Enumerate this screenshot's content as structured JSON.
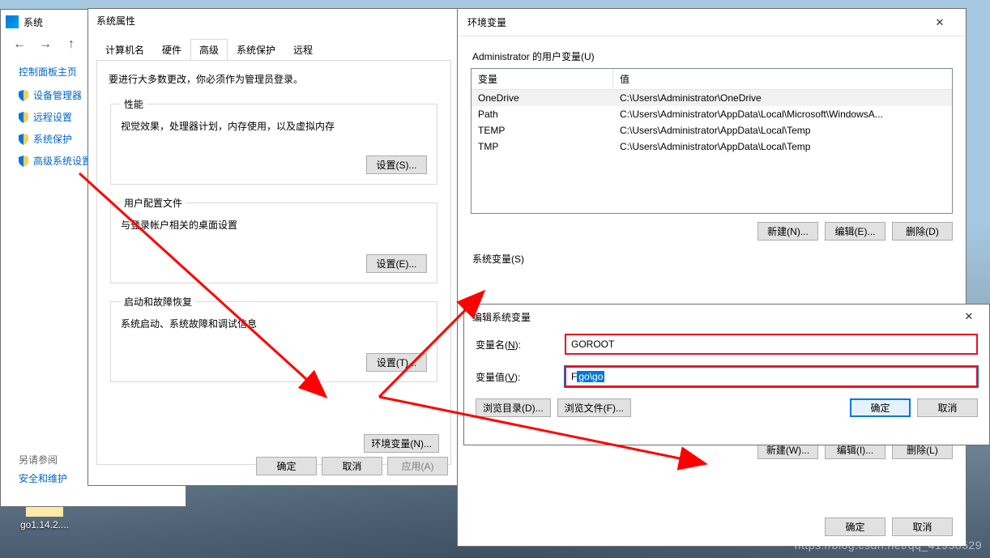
{
  "desktop": {
    "icon_label": "go1.14.2...."
  },
  "system_window": {
    "title": "系统",
    "home": "控制面板主页",
    "links": [
      "设备管理器",
      "远程设置",
      "系统保护",
      "高级系统设置"
    ],
    "see_also": "另请参阅",
    "security": "安全和维护"
  },
  "props": {
    "title": "系统属性",
    "tabs": [
      "计算机名",
      "硬件",
      "高级",
      "系统保护",
      "远程"
    ],
    "active_tab_index": 2,
    "note": "要进行大多数更改，你必须作为管理员登录。",
    "perf_legend": "性能",
    "perf_desc": "视觉效果，处理器计划，内存使用，以及虚拟内存",
    "perf_btn": "设置(S)...",
    "profile_legend": "用户配置文件",
    "profile_desc": "与登录帐户相关的桌面设置",
    "profile_btn": "设置(E)...",
    "startup_legend": "启动和故障恢复",
    "startup_desc": "系统启动、系统故障和调试信息",
    "startup_btn": "设置(T)...",
    "env_btn": "环境变量(N)...",
    "ok": "确定",
    "cancel": "取消",
    "apply": "应用(A)"
  },
  "env": {
    "title": "环境变量",
    "user_label": "Administrator 的用户变量(U)",
    "col_var": "变量",
    "col_val": "值",
    "user_vars": [
      {
        "name": "OneDrive",
        "value": "C:\\Users\\Administrator\\OneDrive"
      },
      {
        "name": "Path",
        "value": "C:\\Users\\Administrator\\AppData\\Local\\Microsoft\\WindowsA..."
      },
      {
        "name": "TEMP",
        "value": "C:\\Users\\Administrator\\AppData\\Local\\Temp"
      },
      {
        "name": "TMP",
        "value": "C:\\Users\\Administrator\\AppData\\Local\\Temp"
      }
    ],
    "new_btn": "新建(N)...",
    "edit_btn": "编辑(E)...",
    "del_btn": "删除(D)",
    "sys_label": "系统变量(S)",
    "sys_new": "新建(W)...",
    "sys_edit": "编辑(I)...",
    "sys_del": "删除(L)",
    "ok": "确定",
    "cancel": "取消"
  },
  "edit": {
    "title": "编辑系统变量",
    "name_label_pre": "变量名(",
    "name_label_u": "N",
    "name_label_post": "):",
    "value_label_pre": "变量值(",
    "value_label_u": "V",
    "value_label_post": "):",
    "name_value": "GOROOT",
    "value_prefix": "F",
    "value_selected": "go\\go",
    "browse_dir": "浏览目录(D)...",
    "browse_file": "浏览文件(F)...",
    "ok": "确定",
    "cancel": "取消"
  },
  "watermark": "https://blog.csdn.net/qq_41958529"
}
